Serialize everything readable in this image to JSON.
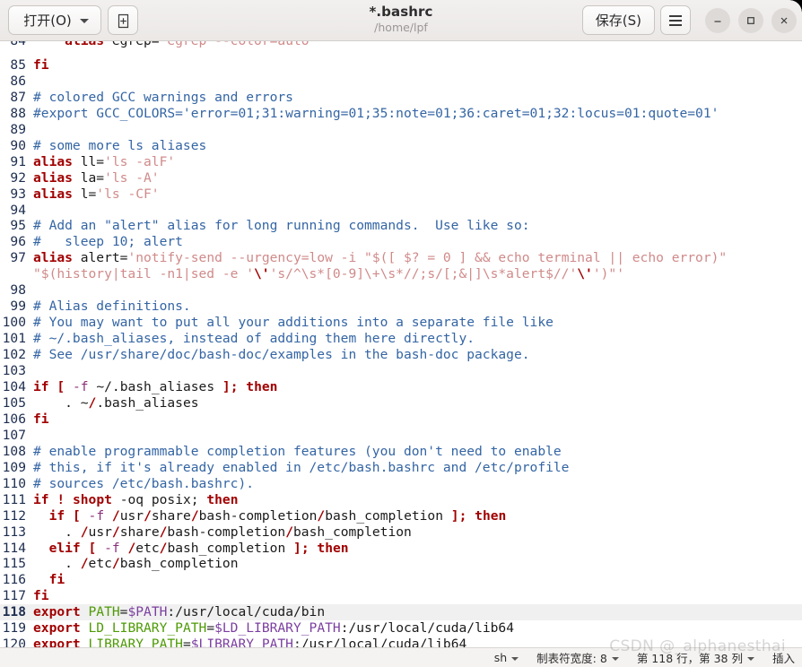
{
  "window": {
    "title": "*.bashrc",
    "subtitle": "/home/lpf",
    "open_button": "打开(O)",
    "new_doc_icon": "new-document-icon",
    "save_button": "保存(S)",
    "menu_icon": "hamburger-menu-icon",
    "minimize_icon": "minimize-icon",
    "maximize_icon": "maximize-icon",
    "close_icon": "close-icon"
  },
  "editor": {
    "current_line": 118,
    "first_visible_line": 84,
    "lines": [
      {
        "n": 84,
        "clipped": true,
        "tokens": [
          {
            "t": "    ",
            "c": "plain"
          },
          {
            "t": "alias",
            "c": "kw"
          },
          {
            "t": " egrep=",
            "c": "plain"
          },
          {
            "t": "'egrep --color=auto'",
            "c": "str"
          }
        ]
      },
      {
        "n": 85,
        "tokens": [
          {
            "t": "fi",
            "c": "kw"
          }
        ]
      },
      {
        "n": 86,
        "tokens": [
          {
            "t": "",
            "c": "plain"
          }
        ]
      },
      {
        "n": 87,
        "tokens": [
          {
            "t": "# colored GCC warnings and errors",
            "c": "cmt"
          }
        ]
      },
      {
        "n": 88,
        "tokens": [
          {
            "t": "#export GCC_COLORS='error=01;31:warning=01;35:note=01;36:caret=01;32:locus=01:quote=01'",
            "c": "cmt"
          }
        ]
      },
      {
        "n": 89,
        "tokens": [
          {
            "t": "",
            "c": "plain"
          }
        ]
      },
      {
        "n": 90,
        "tokens": [
          {
            "t": "# some more ls aliases",
            "c": "cmt"
          }
        ]
      },
      {
        "n": 91,
        "tokens": [
          {
            "t": "alias",
            "c": "kw"
          },
          {
            "t": " ll=",
            "c": "plain"
          },
          {
            "t": "'ls -alF'",
            "c": "str"
          }
        ]
      },
      {
        "n": 92,
        "tokens": [
          {
            "t": "alias",
            "c": "kw"
          },
          {
            "t": " la=",
            "c": "plain"
          },
          {
            "t": "'ls -A'",
            "c": "str"
          }
        ]
      },
      {
        "n": 93,
        "tokens": [
          {
            "t": "alias",
            "c": "kw"
          },
          {
            "t": " l=",
            "c": "plain"
          },
          {
            "t": "'ls -CF'",
            "c": "str"
          }
        ]
      },
      {
        "n": 94,
        "tokens": [
          {
            "t": "",
            "c": "plain"
          }
        ]
      },
      {
        "n": 95,
        "tokens": [
          {
            "t": "# Add an \"alert\" alias for long running commands.  Use like so:",
            "c": "cmt"
          }
        ]
      },
      {
        "n": 96,
        "tokens": [
          {
            "t": "#   sleep 10; alert",
            "c": "cmt"
          }
        ]
      },
      {
        "n": 97,
        "wrap": true,
        "tokens": [
          {
            "t": "alias",
            "c": "kw"
          },
          {
            "t": " alert=",
            "c": "plain"
          },
          {
            "t": "'notify-send --urgency=low -i \"$([ $? = 0 ] && echo terminal || echo error)\" \"$(history|tail -n1|sed -e '",
            "c": "str"
          },
          {
            "t": "\\'",
            "c": "kw"
          },
          {
            "t": "'s/^\\s*[0-9]\\+\\s*//;s/[;&|]\\s*alert$//'",
            "c": "str"
          },
          {
            "t": "\\'",
            "c": "kw"
          },
          {
            "t": "')\"'",
            "c": "str"
          }
        ]
      },
      {
        "n": 98,
        "tokens": [
          {
            "t": "",
            "c": "plain"
          }
        ]
      },
      {
        "n": 99,
        "tokens": [
          {
            "t": "# Alias definitions.",
            "c": "cmt"
          }
        ]
      },
      {
        "n": 100,
        "tokens": [
          {
            "t": "# You may want to put all your additions into a separate file like",
            "c": "cmt"
          }
        ]
      },
      {
        "n": 101,
        "tokens": [
          {
            "t": "# ~/.bash_aliases, instead of adding them here directly.",
            "c": "cmt"
          }
        ]
      },
      {
        "n": 102,
        "tokens": [
          {
            "t": "# See /usr/share/doc/bash-doc/examples in the bash-doc package.",
            "c": "cmt"
          }
        ]
      },
      {
        "n": 103,
        "tokens": [
          {
            "t": "",
            "c": "plain"
          }
        ]
      },
      {
        "n": 104,
        "tokens": [
          {
            "t": "if",
            "c": "kw"
          },
          {
            "t": " ",
            "c": "plain"
          },
          {
            "t": "[",
            "c": "punct"
          },
          {
            "t": " ",
            "c": "plain"
          },
          {
            "t": "-f",
            "c": "opt"
          },
          {
            "t": " ~/.bash_aliases ",
            "c": "plain"
          },
          {
            "t": "];",
            "c": "punct"
          },
          {
            "t": " ",
            "c": "plain"
          },
          {
            "t": "then",
            "c": "kw"
          }
        ]
      },
      {
        "n": 105,
        "tokens": [
          {
            "t": "    . ~",
            "c": "plain"
          },
          {
            "t": "/",
            "c": "kw"
          },
          {
            "t": ".bash_aliases",
            "c": "plain"
          }
        ]
      },
      {
        "n": 106,
        "tokens": [
          {
            "t": "fi",
            "c": "kw"
          }
        ]
      },
      {
        "n": 107,
        "tokens": [
          {
            "t": "",
            "c": "plain"
          }
        ]
      },
      {
        "n": 108,
        "tokens": [
          {
            "t": "# enable programmable completion features (you don't need to enable",
            "c": "cmt"
          }
        ]
      },
      {
        "n": 109,
        "tokens": [
          {
            "t": "# this, if it's already enabled in /etc/bash.bashrc and /etc/profile",
            "c": "cmt"
          }
        ]
      },
      {
        "n": 110,
        "tokens": [
          {
            "t": "# sources /etc/bash.bashrc).",
            "c": "cmt"
          }
        ]
      },
      {
        "n": 111,
        "tokens": [
          {
            "t": "if",
            "c": "kw"
          },
          {
            "t": " ",
            "c": "plain"
          },
          {
            "t": "!",
            "c": "kw"
          },
          {
            "t": " ",
            "c": "plain"
          },
          {
            "t": "shopt",
            "c": "kw"
          },
          {
            "t": " -oq posix; ",
            "c": "plain"
          },
          {
            "t": "then",
            "c": "kw"
          }
        ]
      },
      {
        "n": 112,
        "tokens": [
          {
            "t": "  ",
            "c": "plain"
          },
          {
            "t": "if",
            "c": "kw"
          },
          {
            "t": " ",
            "c": "plain"
          },
          {
            "t": "[",
            "c": "punct"
          },
          {
            "t": " ",
            "c": "plain"
          },
          {
            "t": "-f",
            "c": "opt"
          },
          {
            "t": " ",
            "c": "plain"
          },
          {
            "t": "/",
            "c": "kw"
          },
          {
            "t": "usr",
            "c": "plain"
          },
          {
            "t": "/",
            "c": "kw"
          },
          {
            "t": "share",
            "c": "plain"
          },
          {
            "t": "/",
            "c": "kw"
          },
          {
            "t": "bash-completion",
            "c": "plain"
          },
          {
            "t": "/",
            "c": "kw"
          },
          {
            "t": "bash_completion ",
            "c": "plain"
          },
          {
            "t": "];",
            "c": "punct"
          },
          {
            "t": " ",
            "c": "plain"
          },
          {
            "t": "then",
            "c": "kw"
          }
        ]
      },
      {
        "n": 113,
        "tokens": [
          {
            "t": "    . ",
            "c": "plain"
          },
          {
            "t": "/",
            "c": "kw"
          },
          {
            "t": "usr",
            "c": "plain"
          },
          {
            "t": "/",
            "c": "kw"
          },
          {
            "t": "share",
            "c": "plain"
          },
          {
            "t": "/",
            "c": "kw"
          },
          {
            "t": "bash-completion",
            "c": "plain"
          },
          {
            "t": "/",
            "c": "kw"
          },
          {
            "t": "bash_completion",
            "c": "plain"
          }
        ]
      },
      {
        "n": 114,
        "tokens": [
          {
            "t": "  ",
            "c": "plain"
          },
          {
            "t": "elif",
            "c": "kw"
          },
          {
            "t": " ",
            "c": "plain"
          },
          {
            "t": "[",
            "c": "punct"
          },
          {
            "t": " ",
            "c": "plain"
          },
          {
            "t": "-f",
            "c": "opt"
          },
          {
            "t": " ",
            "c": "plain"
          },
          {
            "t": "/",
            "c": "kw"
          },
          {
            "t": "etc",
            "c": "plain"
          },
          {
            "t": "/",
            "c": "kw"
          },
          {
            "t": "bash_completion ",
            "c": "plain"
          },
          {
            "t": "];",
            "c": "punct"
          },
          {
            "t": " ",
            "c": "plain"
          },
          {
            "t": "then",
            "c": "kw"
          }
        ]
      },
      {
        "n": 115,
        "tokens": [
          {
            "t": "    . ",
            "c": "plain"
          },
          {
            "t": "/",
            "c": "kw"
          },
          {
            "t": "etc",
            "c": "plain"
          },
          {
            "t": "/",
            "c": "kw"
          },
          {
            "t": "bash_completion",
            "c": "plain"
          }
        ]
      },
      {
        "n": 116,
        "tokens": [
          {
            "t": "  ",
            "c": "plain"
          },
          {
            "t": "fi",
            "c": "kw"
          }
        ]
      },
      {
        "n": 117,
        "tokens": [
          {
            "t": "fi",
            "c": "kw"
          }
        ]
      },
      {
        "n": 118,
        "current": true,
        "tokens": [
          {
            "t": "export",
            "c": "kw"
          },
          {
            "t": " ",
            "c": "plain"
          },
          {
            "t": "PATH",
            "c": "name"
          },
          {
            "t": "=",
            "c": "plain"
          },
          {
            "t": "$PATH",
            "c": "var"
          },
          {
            "t": ":/usr/local/cuda/bin",
            "c": "plain"
          }
        ]
      },
      {
        "n": 119,
        "tokens": [
          {
            "t": "export",
            "c": "kw"
          },
          {
            "t": " ",
            "c": "plain"
          },
          {
            "t": "LD_LIBRARY_PATH",
            "c": "name"
          },
          {
            "t": "=",
            "c": "plain"
          },
          {
            "t": "$LD_LIBRARY_PATH",
            "c": "var"
          },
          {
            "t": ":/usr/local/cuda/lib64",
            "c": "plain"
          }
        ]
      },
      {
        "n": 120,
        "tokens": [
          {
            "t": "export",
            "c": "kw"
          },
          {
            "t": " ",
            "c": "plain"
          },
          {
            "t": "LIBRARY_PATH",
            "c": "name"
          },
          {
            "t": "=",
            "c": "plain"
          },
          {
            "t": "$LIBRARY_PATH",
            "c": "var"
          },
          {
            "t": ":/usr/local/cuda/lib64",
            "c": "plain"
          }
        ]
      }
    ]
  },
  "statusbar": {
    "language": "sh",
    "tab_width_label": "制表符宽度: 8",
    "position_label": "第 118 行，第 38 列",
    "insert_mode": "插入",
    "watermark": "CSDN @_alphanesthai"
  },
  "colors": {
    "keyword": "#a10000",
    "comment": "#3465a4",
    "string": "#d08a8a",
    "variable": "#7b3fa0",
    "varname": "#4e9a06",
    "gutter": "#1d2d4f",
    "current_line_bg": "#f0f0f0"
  }
}
